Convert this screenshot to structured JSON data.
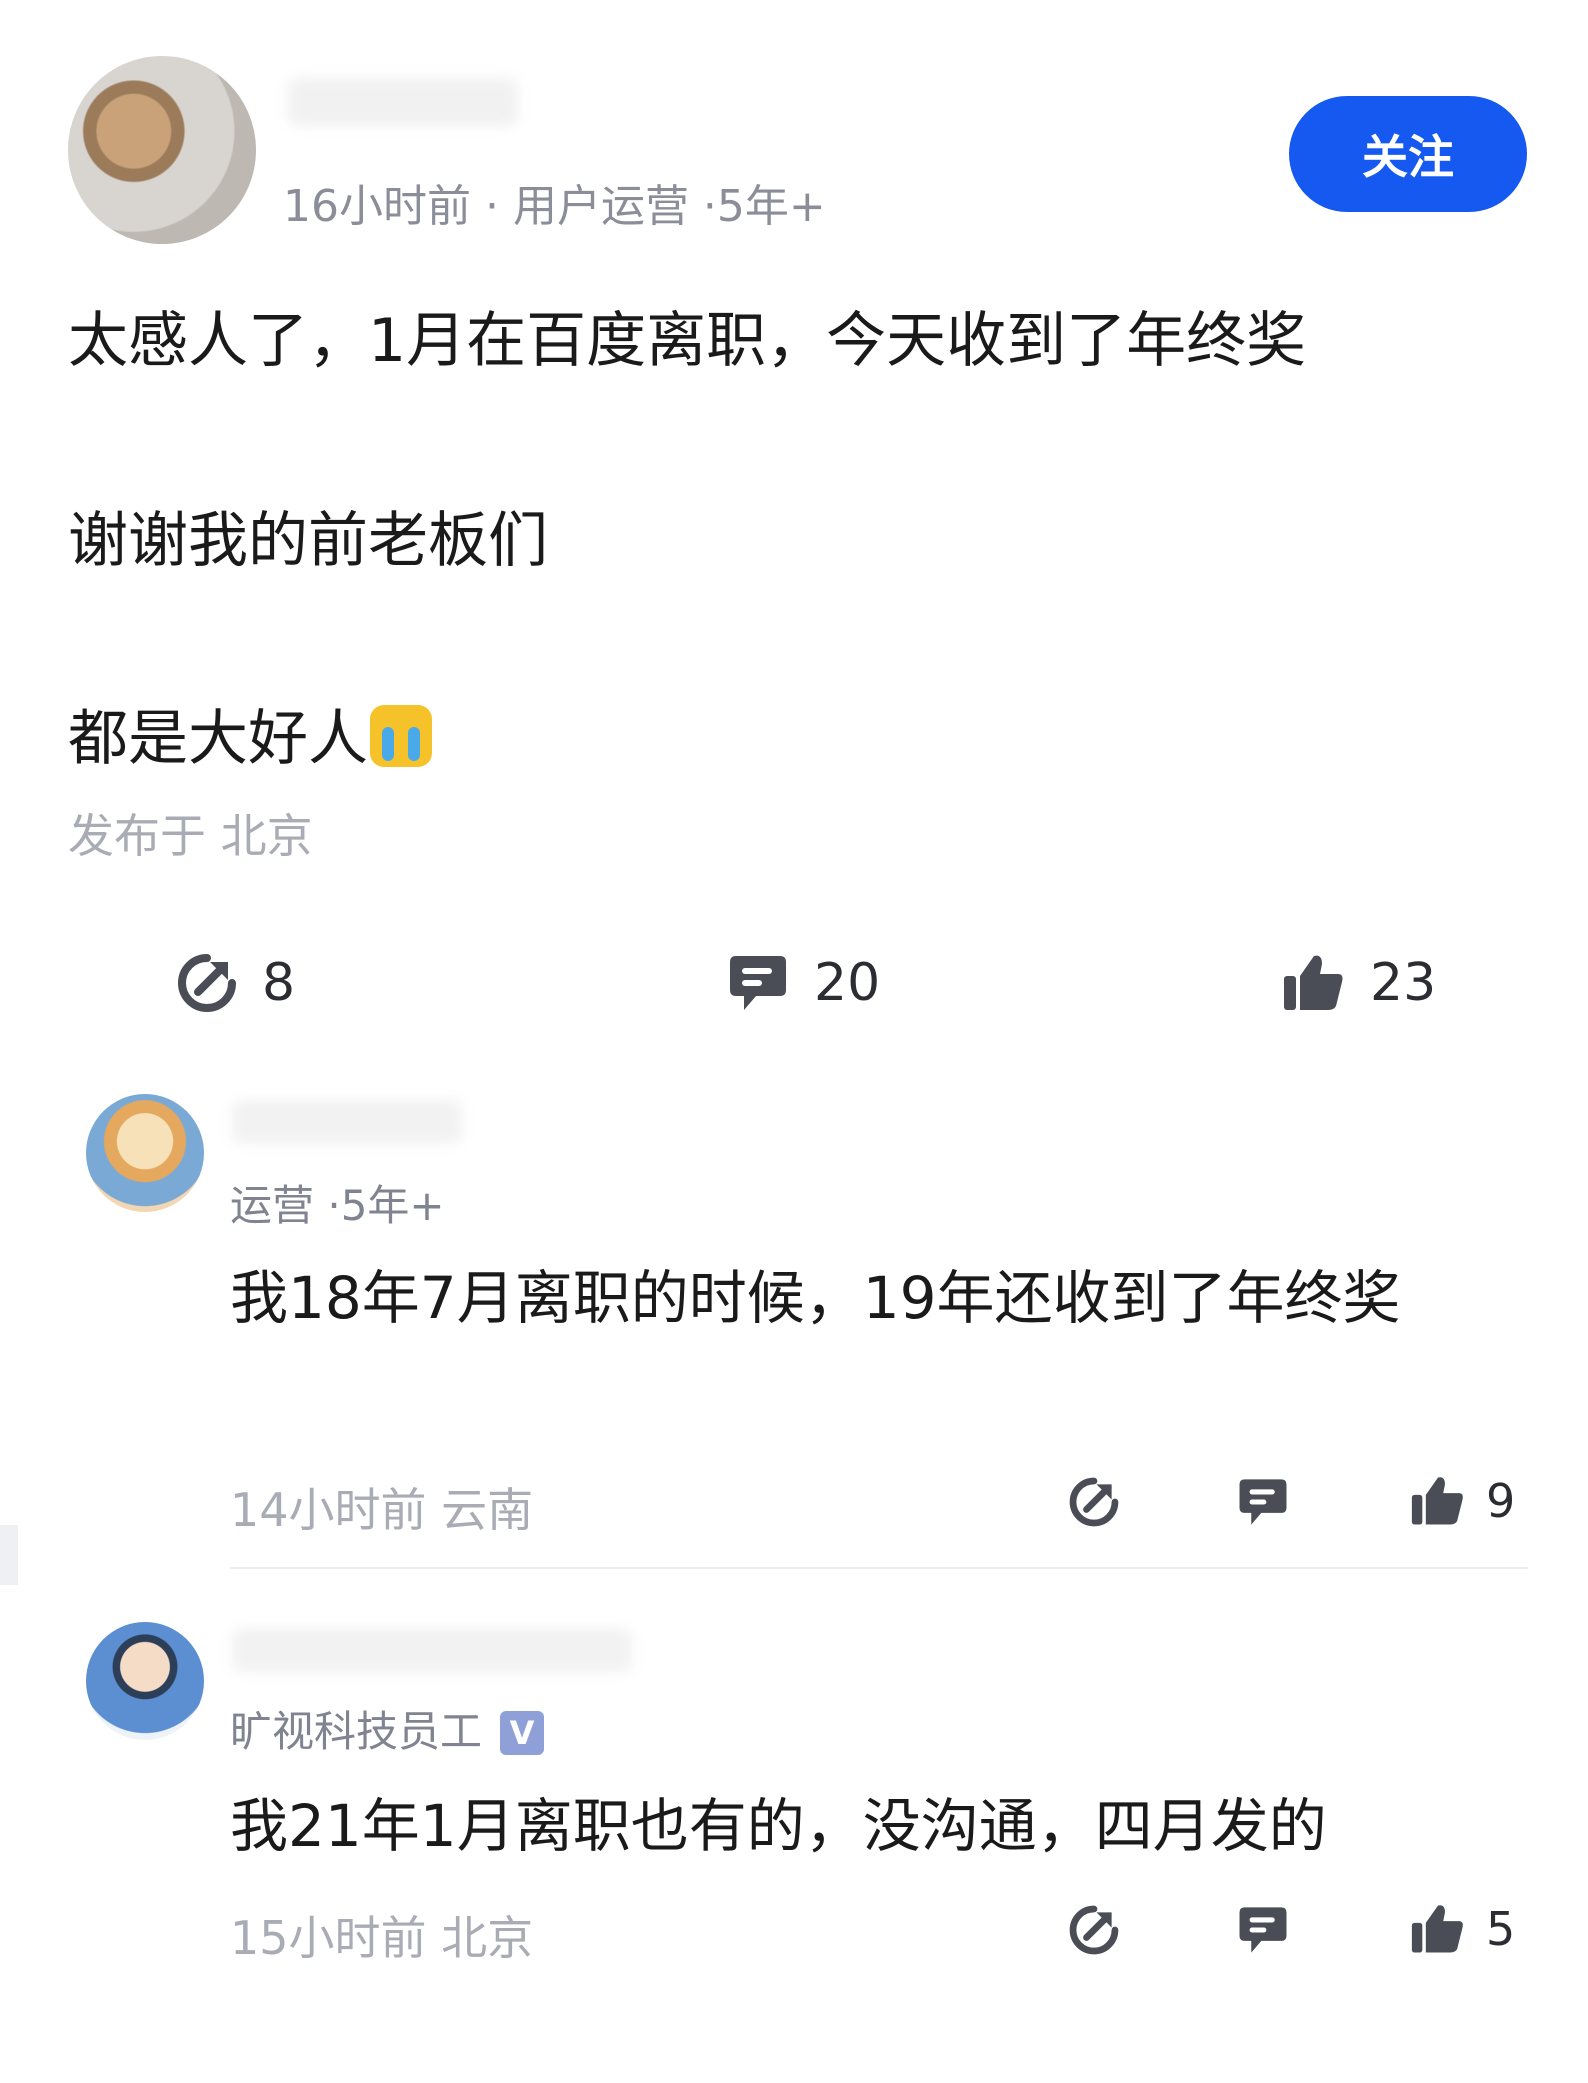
{
  "post": {
    "meta": "16小时前 · 用户运营 ·5年+",
    "follow_label": "关注",
    "lines": [
      "太感人了，1月在百度离职，今天收到了年终奖",
      "谢谢我的前老板们",
      "都是大好人"
    ],
    "location": "发布于 北京",
    "actions": {
      "share_count": "8",
      "comment_count": "20",
      "like_count": "23"
    }
  },
  "comments": [
    {
      "meta": "运营 ·5年+",
      "text": "我18年7月离职的时候，19年还收到了年终奖",
      "time_location": "14小时前  云南",
      "like_count": "9"
    },
    {
      "meta": "旷视科技员工",
      "verified_badge": "V",
      "text": "我21年1月离职也有的，没沟通，四月发的",
      "time_location": "15小时前  北京",
      "like_count": "5"
    }
  ],
  "icons": {
    "share": "share-icon",
    "comment": "comment-icon",
    "like": "thumbs-up-icon",
    "emoji": "crying-face-emoji"
  },
  "colors": {
    "accent": "#1559f0",
    "muted_text": "#a9acb4",
    "icon": "#4a4d55"
  }
}
